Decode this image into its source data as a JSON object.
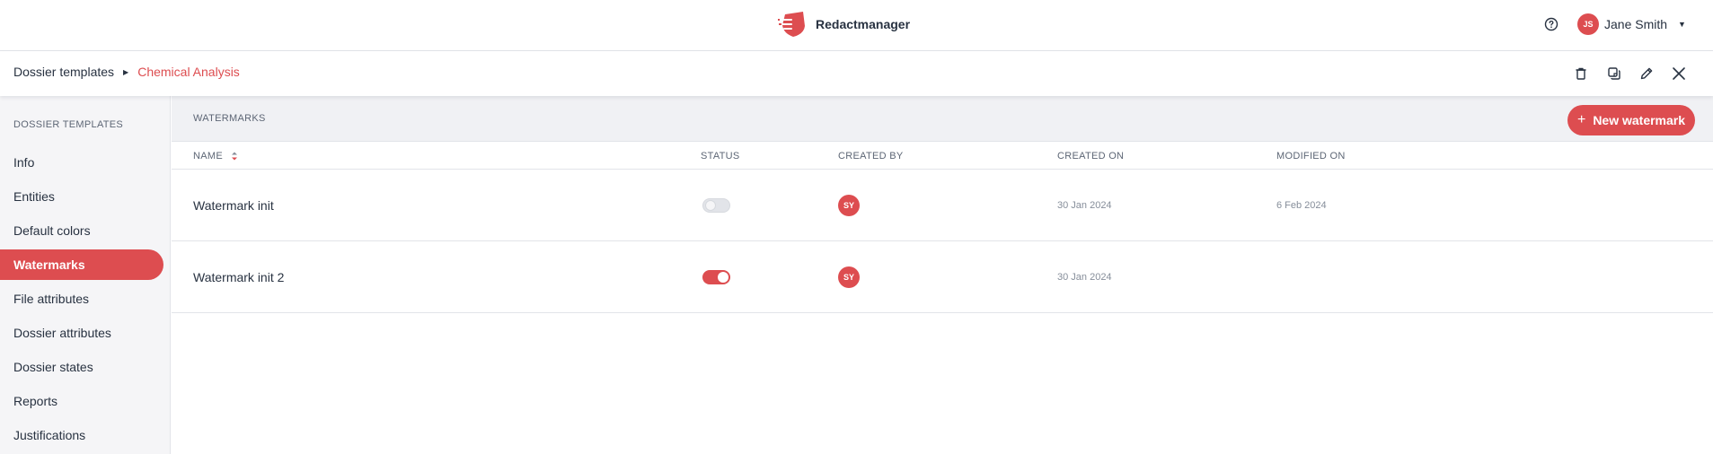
{
  "app": {
    "name": "Redactmanager",
    "brand_color": "#dd4d50"
  },
  "user": {
    "initials": "JS",
    "name": "Jane Smith"
  },
  "breadcrumb": {
    "parent": "Dossier templates",
    "current": "Chemical Analysis"
  },
  "actions": [
    "trash-icon",
    "copy-icon",
    "edit-icon",
    "close-icon"
  ],
  "sidebar": {
    "title": "DOSSIER TEMPLATES",
    "items": [
      {
        "label": "Info",
        "active": false
      },
      {
        "label": "Entities",
        "active": false
      },
      {
        "label": "Default colors",
        "active": false
      },
      {
        "label": "Watermarks",
        "active": true
      },
      {
        "label": "File attributes",
        "active": false
      },
      {
        "label": "Dossier attributes",
        "active": false
      },
      {
        "label": "Dossier states",
        "active": false
      },
      {
        "label": "Reports",
        "active": false
      },
      {
        "label": "Justifications",
        "active": false
      }
    ]
  },
  "main": {
    "section_title": "WATERMARKS",
    "new_button_label": "New watermark",
    "columns": {
      "name": "NAME",
      "status": "STATUS",
      "created_by": "CREATED BY",
      "created_on": "CREATED ON",
      "modified_on": "MODIFIED ON"
    },
    "rows": [
      {
        "name": "Watermark init",
        "enabled": false,
        "created_by": "SY",
        "created_on": "30 Jan 2024",
        "modified_on": "6 Feb 2024"
      },
      {
        "name": "Watermark init 2",
        "enabled": true,
        "created_by": "SY",
        "created_on": "30 Jan 2024",
        "modified_on": ""
      }
    ]
  }
}
